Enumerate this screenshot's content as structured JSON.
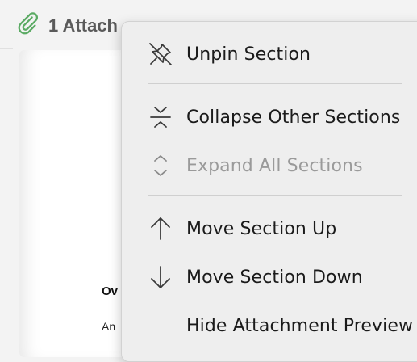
{
  "attachments_header": {
    "label": "1 Attach",
    "icon": "paperclip-icon",
    "icon_color": "#5aaa63"
  },
  "preview": {
    "heading": "Ov",
    "body_text": "An"
  },
  "menu": {
    "items": [
      {
        "label": "Unpin Section",
        "icon": "unpin-icon",
        "enabled": true
      },
      {
        "label": "Collapse Other Sections",
        "icon": "collapse-icon",
        "enabled": true
      },
      {
        "label": "Expand All Sections",
        "icon": "expand-icon",
        "enabled": false
      },
      {
        "label": "Move Section Up",
        "icon": "arrow-up-icon",
        "enabled": true
      },
      {
        "label": "Move Section Down",
        "icon": "arrow-down-icon",
        "enabled": true
      },
      {
        "label": "Hide Attachment Preview",
        "icon": "",
        "enabled": true
      }
    ]
  }
}
